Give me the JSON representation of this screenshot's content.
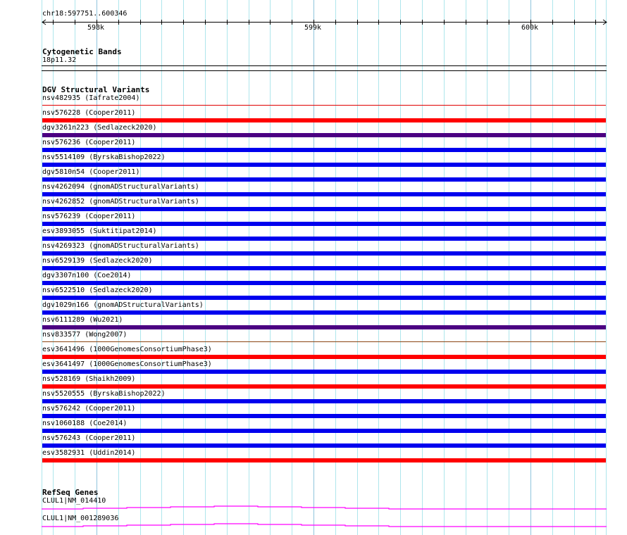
{
  "ruler": {
    "location": "chr18:597751..600346",
    "ticks": [
      "598k",
      "599k",
      "600k"
    ]
  },
  "cytoband": {
    "title": "Cytogenetic Bands",
    "band": "18p11.32"
  },
  "dgv": {
    "title": "DGV Structural Variants",
    "colors": {
      "loss": "#ff0000",
      "gain": "#0000ee",
      "both": "#4b0082",
      "other": "#8b4513"
    },
    "rows": [
      {
        "label": "nsv482935 (Iafrate2004)",
        "type": "thin",
        "color": "#e00000"
      },
      {
        "label": "nsv576228 (Cooper2011)",
        "type": "bar",
        "color": "#ff0000"
      },
      {
        "label": "dgv3261n223 (Sedlazeck2020)",
        "type": "bar",
        "color": "#4b0082"
      },
      {
        "label": "nsv576236 (Cooper2011)",
        "type": "bar",
        "color": "#0000ee"
      },
      {
        "label": "nsv5514109 (ByrskaBishop2022)",
        "type": "bar",
        "color": "#0000ee"
      },
      {
        "label": "dgv5810n54 (Cooper2011)",
        "type": "bar",
        "color": "#0000ee"
      },
      {
        "label": "nsv4262094 (gnomADStructuralVariants)",
        "type": "bar",
        "color": "#0000ee"
      },
      {
        "label": "nsv4262852 (gnomADStructuralVariants)",
        "type": "bar",
        "color": "#0000ee"
      },
      {
        "label": "nsv576239 (Cooper2011)",
        "type": "bar",
        "color": "#0000ee"
      },
      {
        "label": "esv3893055 (Suktitipat2014)",
        "type": "bar",
        "color": "#0000ee"
      },
      {
        "label": "nsv4269323 (gnomADStructuralVariants)",
        "type": "bar",
        "color": "#0000ee"
      },
      {
        "label": "nsv6529139 (Sedlazeck2020)",
        "type": "bar",
        "color": "#0000ee"
      },
      {
        "label": "dgv3307n100 (Coe2014)",
        "type": "bar",
        "color": "#0000ee"
      },
      {
        "label": "nsv6522510 (Sedlazeck2020)",
        "type": "bar",
        "color": "#0000ee"
      },
      {
        "label": "dgv1029n166 (gnomADStructuralVariants)",
        "type": "bar",
        "color": "#0000ee"
      },
      {
        "label": "nsv6111289 (Wu2021)",
        "type": "bar",
        "color": "#4b0082"
      },
      {
        "label": "nsv833577 (Wong2007)",
        "type": "thin",
        "color": "#8b4513"
      },
      {
        "label": "esv3641496 (1000GenomesConsortiumPhase3)",
        "type": "bar",
        "color": "#ff0000"
      },
      {
        "label": "esv3641497 (1000GenomesConsortiumPhase3)",
        "type": "bar",
        "color": "#0000ee"
      },
      {
        "label": "nsv528169 (Shaikh2009)",
        "type": "bar",
        "color": "#ff0000"
      },
      {
        "label": "nsv5520555 (ByrskaBishop2022)",
        "type": "bar",
        "color": "#0000ee"
      },
      {
        "label": "nsv576242 (Cooper2011)",
        "type": "bar",
        "color": "#0000ee"
      },
      {
        "label": "nsv1060188 (Coe2014)",
        "type": "bar",
        "color": "#0000ee"
      },
      {
        "label": "nsv576243 (Cooper2011)",
        "type": "bar",
        "color": "#0000ee"
      },
      {
        "label": "esv3582931 (Uddin2014)",
        "type": "bar",
        "color": "#ff0000"
      }
    ]
  },
  "refseq": {
    "title": "RefSeq Genes",
    "color": "#ff00ff",
    "genes": [
      {
        "label": "CLUL1|NM_014410"
      },
      {
        "label": "CLUL1|NM_001289036"
      }
    ]
  }
}
